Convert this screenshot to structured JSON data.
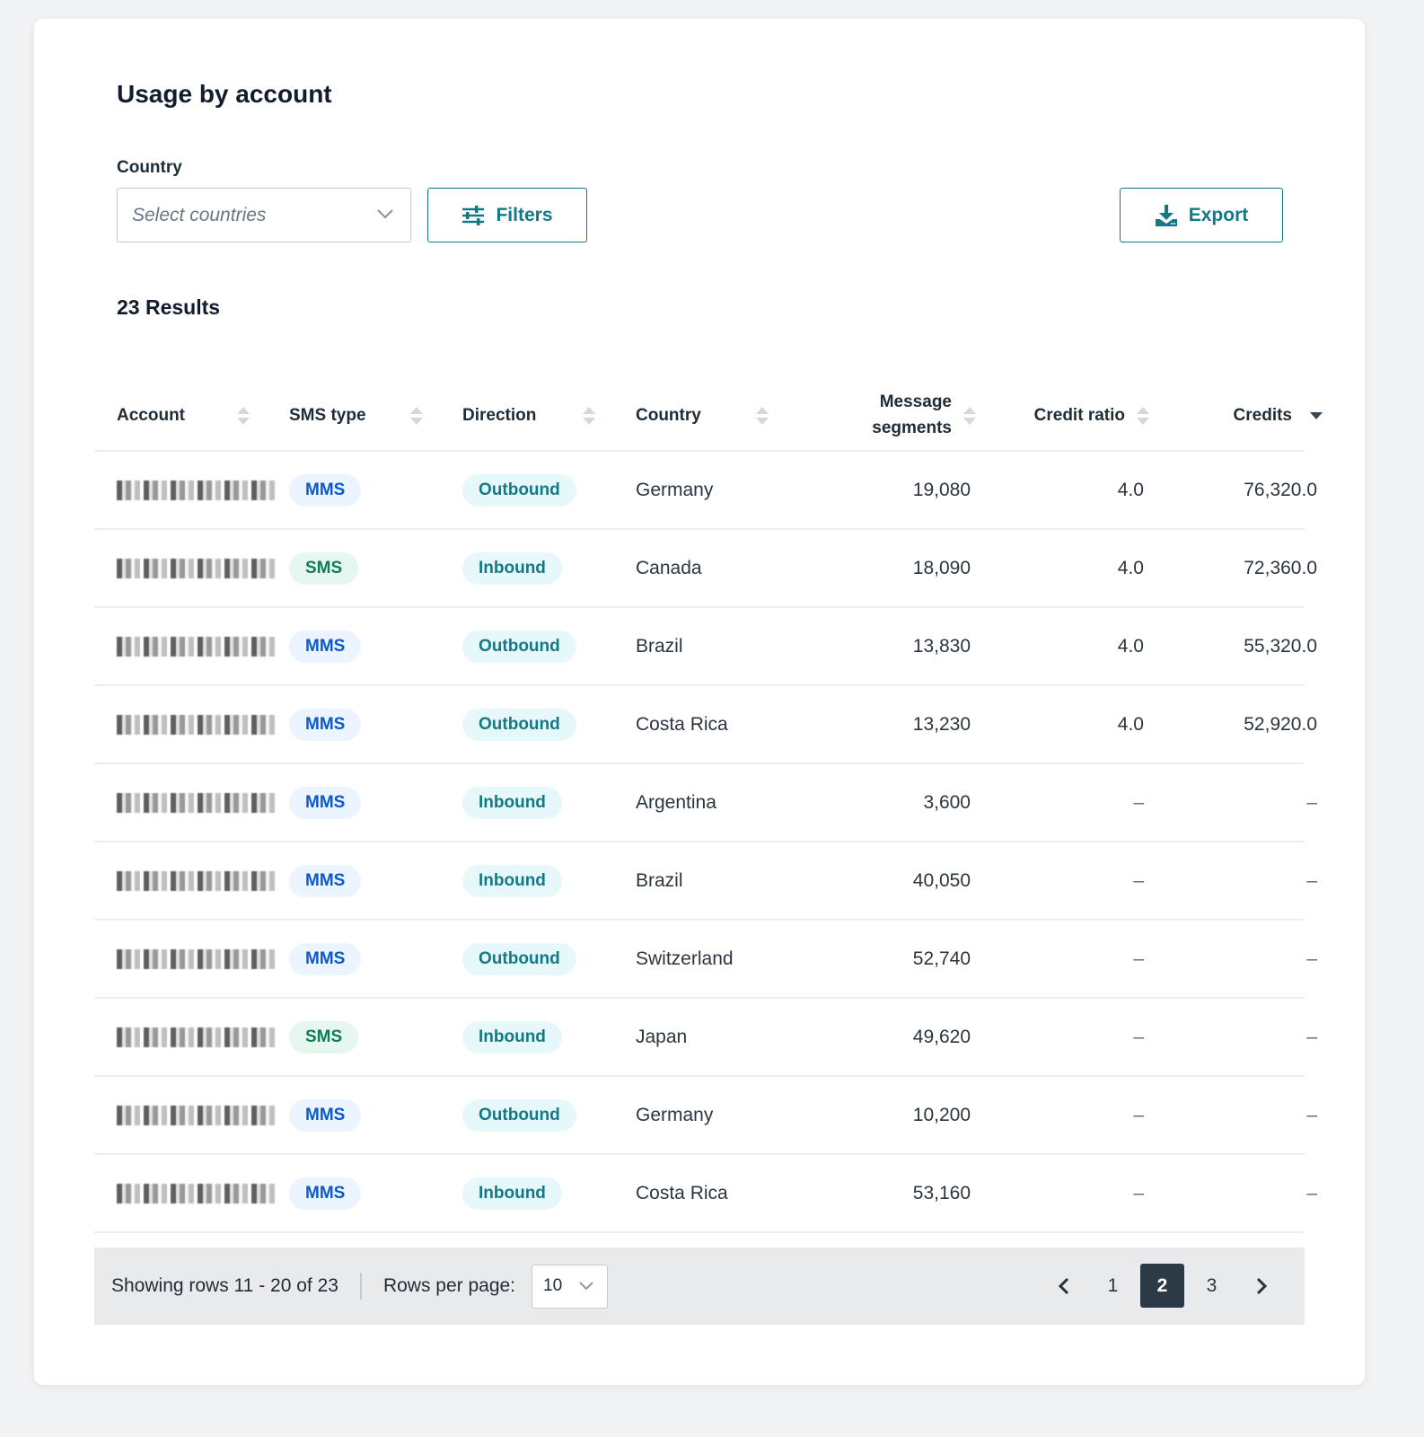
{
  "title": "Usage by account",
  "filters": {
    "country_label": "Country",
    "country_placeholder": "Select countries",
    "filters_button": "Filters",
    "export_button": "Export"
  },
  "results_label": "23 Results",
  "table": {
    "columns": [
      {
        "key": "account",
        "label": "Account",
        "sort": "none"
      },
      {
        "key": "sms_type",
        "label": "SMS type",
        "sort": "none"
      },
      {
        "key": "direction",
        "label": "Direction",
        "sort": "none"
      },
      {
        "key": "country",
        "label": "Country",
        "sort": "none"
      },
      {
        "key": "message_segments",
        "label": "Message segments",
        "label_line1": "Message",
        "label_line2": "segments",
        "sort": "none"
      },
      {
        "key": "credit_ratio",
        "label": "Credit ratio",
        "sort": "none"
      },
      {
        "key": "credits",
        "label": "Credits",
        "sort": "descending"
      }
    ],
    "rows": [
      {
        "account": "[redacted]",
        "sms_type": "MMS",
        "direction": "Outbound",
        "country": "Germany",
        "message_segments": "19,080",
        "credit_ratio": "4.0",
        "credits": "76,320.0"
      },
      {
        "account": "[redacted]",
        "sms_type": "SMS",
        "direction": "Inbound",
        "country": "Canada",
        "message_segments": "18,090",
        "credit_ratio": "4.0",
        "credits": "72,360.0"
      },
      {
        "account": "[redacted]",
        "sms_type": "MMS",
        "direction": "Outbound",
        "country": "Brazil",
        "message_segments": "13,830",
        "credit_ratio": "4.0",
        "credits": "55,320.0"
      },
      {
        "account": "[redacted]",
        "sms_type": "MMS",
        "direction": "Outbound",
        "country": "Costa Rica",
        "message_segments": "13,230",
        "credit_ratio": "4.0",
        "credits": "52,920.0"
      },
      {
        "account": "[redacted]",
        "sms_type": "MMS",
        "direction": "Inbound",
        "country": "Argentina",
        "message_segments": "3,600",
        "credit_ratio": "–",
        "credits": "–"
      },
      {
        "account": "[redacted]",
        "sms_type": "MMS",
        "direction": "Inbound",
        "country": "Brazil",
        "message_segments": "40,050",
        "credit_ratio": "–",
        "credits": "–"
      },
      {
        "account": "[redacted]",
        "sms_type": "MMS",
        "direction": "Outbound",
        "country": "Switzerland",
        "message_segments": "52,740",
        "credit_ratio": "–",
        "credits": "–"
      },
      {
        "account": "[redacted]",
        "sms_type": "SMS",
        "direction": "Inbound",
        "country": "Japan",
        "message_segments": "49,620",
        "credit_ratio": "–",
        "credits": "–"
      },
      {
        "account": "[redacted]",
        "sms_type": "MMS",
        "direction": "Outbound",
        "country": "Germany",
        "message_segments": "10,200",
        "credit_ratio": "–",
        "credits": "–"
      },
      {
        "account": "[redacted]",
        "sms_type": "MMS",
        "direction": "Inbound",
        "country": "Costa Rica",
        "message_segments": "53,160",
        "credit_ratio": "–",
        "credits": "–"
      }
    ]
  },
  "footer": {
    "showing": "Showing rows 11 - 20 of 23",
    "rows_per_page_label": "Rows per page:",
    "rows_per_page_value": "10",
    "pages": [
      "1",
      "2",
      "3"
    ],
    "current_page": "2"
  },
  "colors": {
    "accent": "#127a87",
    "mms_pill_bg": "#ebf4ff",
    "mms_pill_text": "#0c59c8",
    "sms_pill_bg": "#e5f7ef",
    "sms_pill_text": "#0f7d54",
    "direction_pill_bg": "#e6f8fa",
    "direction_pill_text": "#137a85",
    "active_page_bg": "#2c3a48"
  },
  "icons": {
    "filters": "sliders-icon",
    "export": "download-icon",
    "select": "chevron-down-icon",
    "sort": "sort-icon",
    "prev": "chevron-left-icon",
    "next": "chevron-right-icon"
  }
}
